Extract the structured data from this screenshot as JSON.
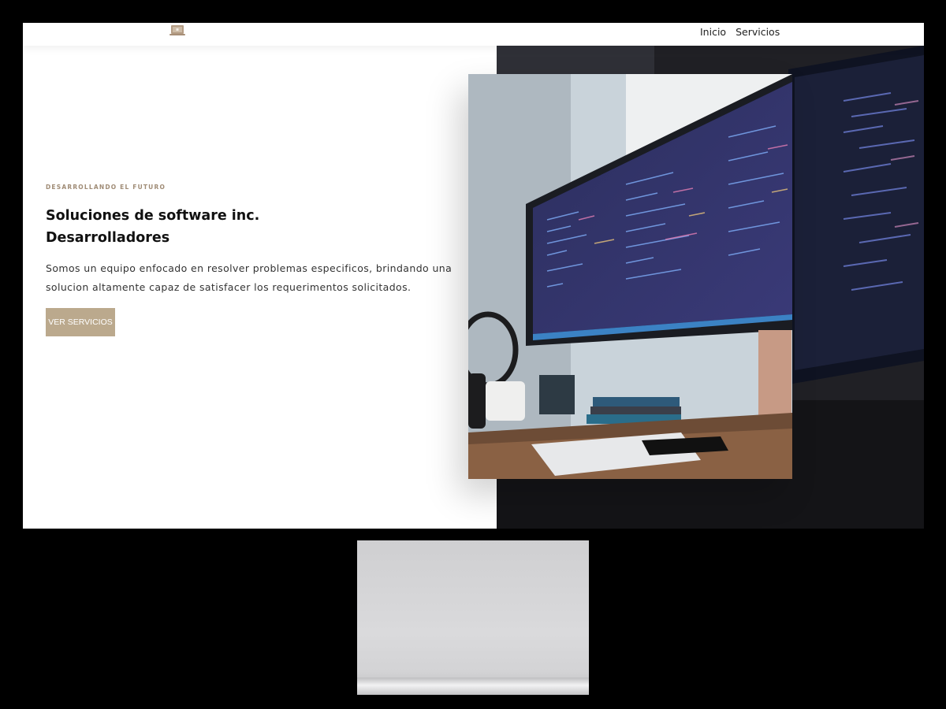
{
  "nav": {
    "links": [
      "Inicio",
      "Servicios"
    ]
  },
  "hero": {
    "overline": "DESARROLLANDO EL FUTURO",
    "title_line1": "Soluciones de software inc.",
    "title_line2": "Desarrolladores",
    "description": "Somos un equipo enfocado en resolver problemas especificos, brindando una solucion altamente capaz de satisfacer los requerimentos solicitados.",
    "cta_label": "VER SERVICIOS"
  },
  "icons": {
    "logo": "laptop-icon"
  },
  "colors": {
    "accent": "#bba98d",
    "overline": "#a08c76",
    "right_panel": "#1d1d22"
  }
}
